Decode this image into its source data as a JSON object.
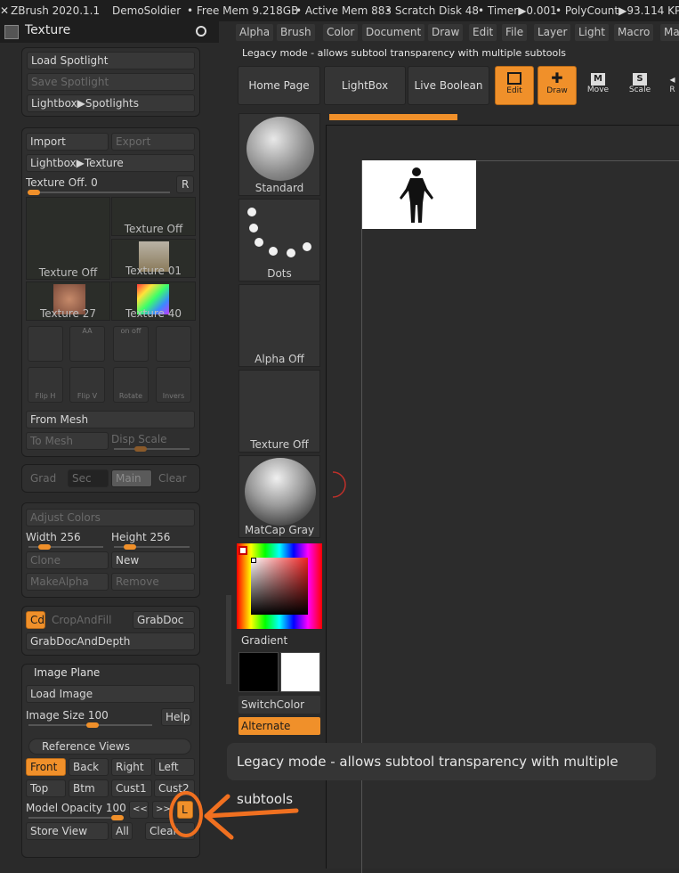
{
  "titlebar": {
    "app": "ZBrush 2020.1.1",
    "project": "DemoSoldier",
    "free_mem": "• Free Mem 9.218GB",
    "active_mem": "• Active Mem 883",
    "scratch": "• Scratch Disk 48",
    "timer": "• Timer▶0.001",
    "polycount": "• PolyCount▶93.114 KP"
  },
  "left_header": {
    "title": "Texture"
  },
  "menus": [
    "Alpha",
    "Brush",
    "Color",
    "Document",
    "Draw",
    "Edit",
    "File",
    "Layer",
    "Light",
    "Macro",
    "Ma"
  ],
  "legacy_text": "Legacy mode - allows subtool transparency with multiple subtools",
  "top_buttons": {
    "home": "Home Page",
    "lightbox": "LightBox",
    "live_boolean": "Live Boolean"
  },
  "tools": {
    "edit": "Edit",
    "draw": "Draw",
    "move": "Move",
    "scale": "Scale",
    "rotate": "R"
  },
  "spotlight": {
    "load": "Load Spotlight",
    "save": "Save Spotlight",
    "lightbox": "Lightbox▶Spotlights"
  },
  "texture": {
    "import": "Import",
    "export": "Export",
    "lightbox": "Lightbox▶Texture",
    "offset_label": "Texture Off.",
    "offset_value": "0",
    "r": "R",
    "thumbs": [
      "Texture Off",
      "Texture Off",
      "Texture 01",
      "Texture 27",
      "Texture 40"
    ],
    "flip_h": "Flip H",
    "flip_v": "Flip V",
    "rotate": "Rotate",
    "invers": "Invers",
    "on": "on",
    "off": "off",
    "aa": "AA",
    "from_mesh": "From Mesh",
    "to_mesh": "To Mesh",
    "disp_scale": "Disp Scale"
  },
  "grad": {
    "grad": "Grad",
    "sec": "Sec",
    "main": "Main",
    "clear": "Clear"
  },
  "adjust": {
    "adjust_colors": "Adjust Colors",
    "width_label": "Width",
    "width_value": "256",
    "height_label": "Height",
    "height_value": "256",
    "clone": "Clone",
    "new": "New",
    "make_alpha": "MakeAlpha",
    "remove": "Remove"
  },
  "grab": {
    "cd": "Cd",
    "crop": "CropAndFill",
    "grabdoc": "GrabDoc",
    "grabdepth": "GrabDocAndDepth"
  },
  "image_plane": {
    "title": "Image Plane",
    "load": "Load Image",
    "size_label": "Image Size",
    "size_value": "100",
    "help": "Help",
    "ref_views": "Reference Views",
    "front": "Front",
    "back": "Back",
    "right": "Right",
    "left": "Left",
    "top": "Top",
    "btm": "Btm",
    "cust1": "Cust1",
    "cust2": "Cust2",
    "opacity_label": "Model Opacity",
    "opacity_value": "100",
    "prev": "<<",
    "next": ">>",
    "l": "L",
    "store": "Store View",
    "all": "All",
    "clear": "Clear"
  },
  "mid": {
    "standard": "Standard",
    "dots": "Dots",
    "alpha_off": "Alpha Off",
    "texture_off": "Texture Off",
    "matcap": "MatCap Gray",
    "gradient": "Gradient",
    "switch_color": "SwitchColor",
    "alternate": "Alternate"
  },
  "tooltip": "Legacy mode - allows subtool transparency with multiple subtools",
  "colors": {
    "accent": "#f0902a",
    "background": "#2a2a2a",
    "button": "#383838"
  },
  "slider_levels": {
    "texture_offset": 0.0,
    "width": 0.2,
    "height": 0.2,
    "image_size": 0.5,
    "model_opacity": 1.0
  },
  "icons": [
    "texture-icon",
    "pin-icon",
    "edit-icon",
    "draw-icon",
    "move-icon",
    "scale-icon",
    "figure-silhouette-icon",
    "cursor-circle-icon",
    "annotation-arrow-icon"
  ]
}
